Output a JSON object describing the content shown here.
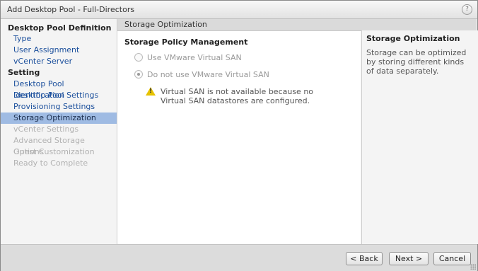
{
  "window": {
    "title": "Add Desktop Pool - Full-Directors",
    "help_symbol": "?"
  },
  "nav": {
    "sections": [
      {
        "label": "Desktop Pool Definition"
      },
      {
        "label": "Setting"
      }
    ],
    "items": [
      {
        "label": "Type",
        "state": "link"
      },
      {
        "label": "User Assignment",
        "state": "link"
      },
      {
        "label": "vCenter Server",
        "state": "link"
      },
      {
        "label": "Desktop Pool Identification",
        "state": "link"
      },
      {
        "label": "Desktop Pool Settings",
        "state": "link"
      },
      {
        "label": "Provisioning Settings",
        "state": "link"
      },
      {
        "label": "Storage Optimization",
        "state": "active"
      },
      {
        "label": "vCenter Settings",
        "state": "disabled"
      },
      {
        "label": "Advanced Storage Options",
        "state": "disabled"
      },
      {
        "label": "Guest Customization",
        "state": "disabled"
      },
      {
        "label": "Ready to Complete",
        "state": "disabled"
      }
    ]
  },
  "content": {
    "header": "Storage Optimization",
    "section_title": "Storage Policy Management",
    "options": [
      {
        "label": "Use VMware Virtual SAN",
        "checked": false,
        "enabled": false
      },
      {
        "label": "Do not use VMware Virtual SAN",
        "checked": true,
        "enabled": false
      }
    ],
    "warning": "Virtual SAN is not available because no Virtual SAN datastores are configured."
  },
  "help": {
    "title": "Storage Optimization",
    "text": "Storage can be optimized by storing different kinds of data separately."
  },
  "footer": {
    "back_label": "< Back",
    "next_label": "Next >",
    "cancel_label": "Cancel"
  },
  "colors": {
    "active_item_bg": "#9fbbe3",
    "link": "#1b4f9c",
    "warning": "#e6c200"
  }
}
